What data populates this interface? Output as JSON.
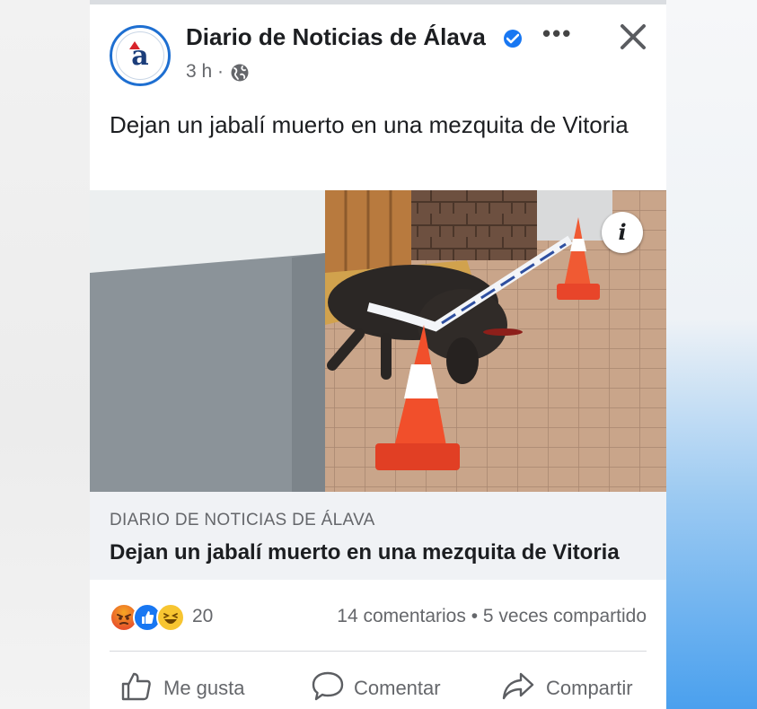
{
  "post": {
    "page_name": "Diario de Noticias de Álava",
    "avatar_letter": "a",
    "time": "3 h",
    "separator": "·",
    "more_label": "•••",
    "text": "Dejan un jabalí muerto en una mezquita de Vitoria"
  },
  "media": {
    "info_label": "i"
  },
  "link": {
    "domain": "DIARIO DE NOTICIAS DE ÁLAVA",
    "title": "Dejan un jabalí muerto en una mezquita de Vitoria"
  },
  "engagement": {
    "reaction_icons": [
      "angry-icon",
      "like-icon",
      "haha-icon"
    ],
    "reaction_count": "20",
    "comments": "14 comentarios",
    "bullet": "•",
    "shares": "5 veces compartido"
  },
  "actions": {
    "like": "Me gusta",
    "comment": "Comentar",
    "share": "Compartir"
  },
  "colors": {
    "brand_blue": "#1877f2",
    "text_primary": "#1c1e21",
    "text_secondary": "#65676b",
    "link_bg": "#f0f2f5"
  }
}
